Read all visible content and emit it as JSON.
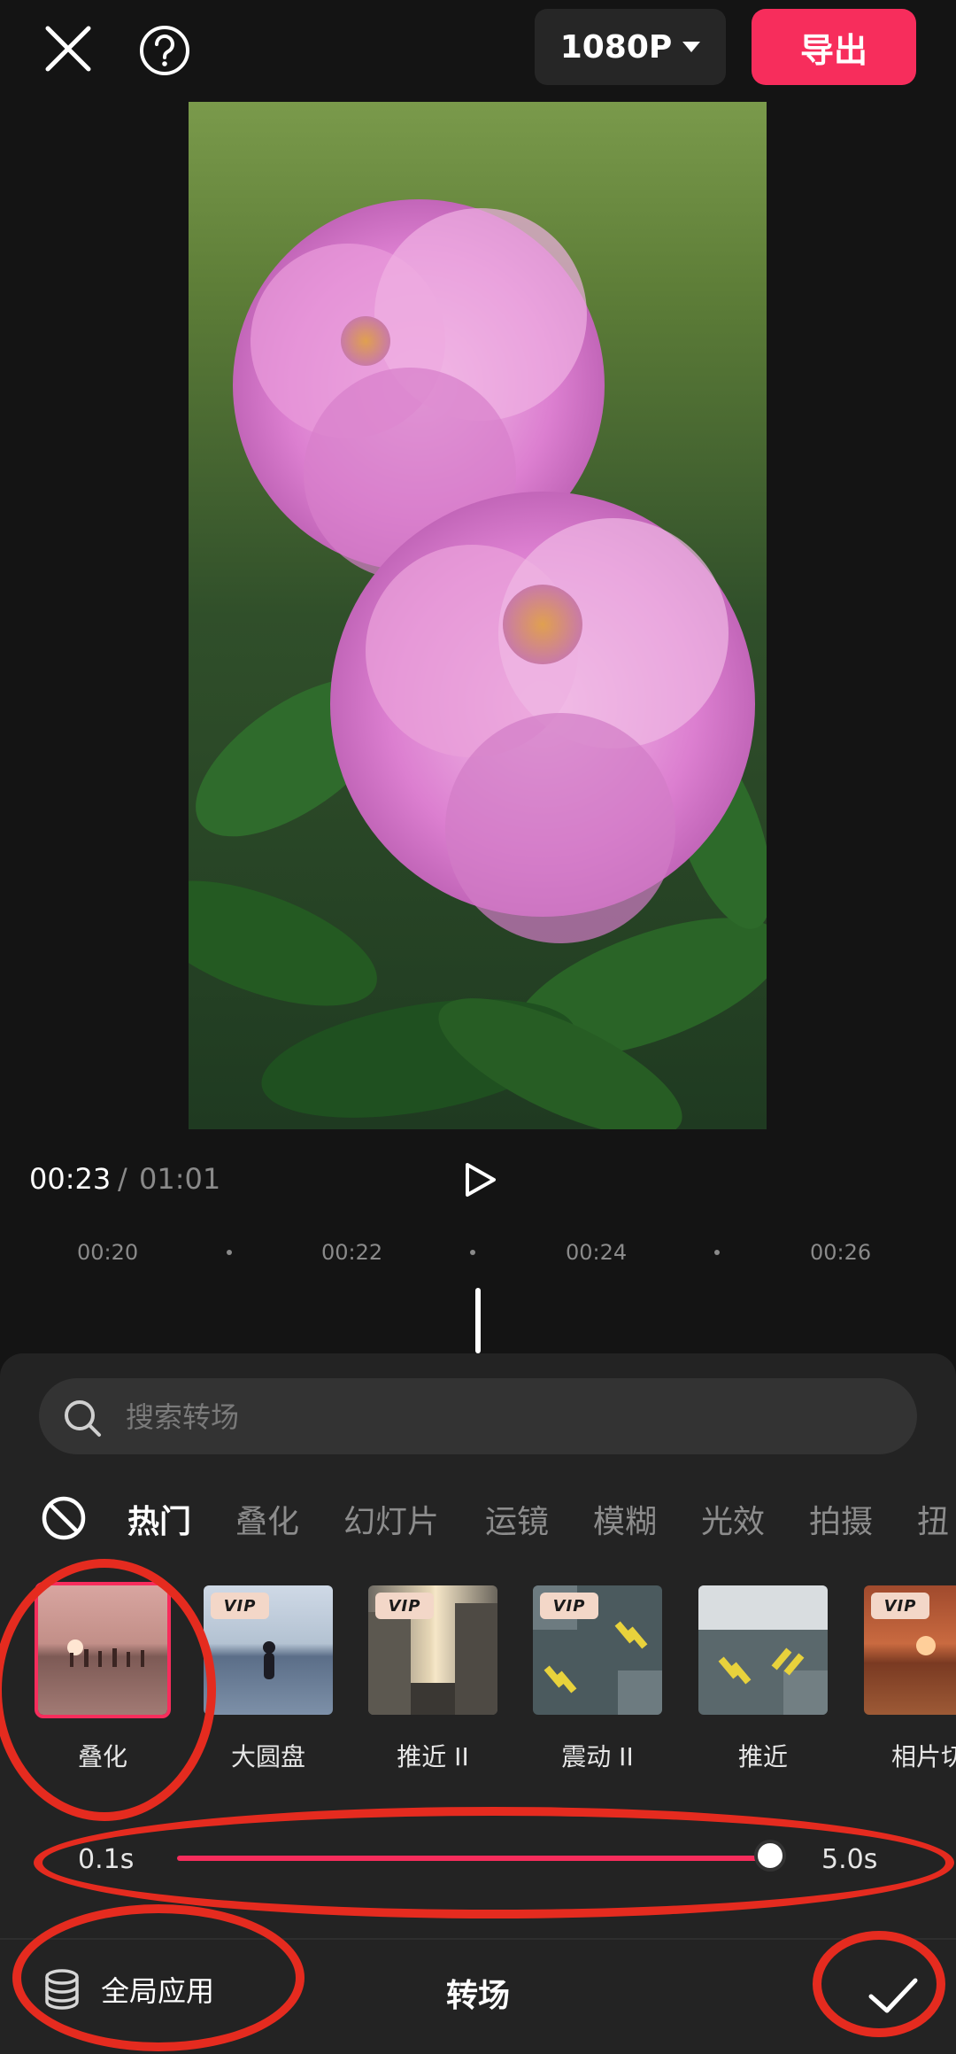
{
  "top_bar": {
    "resolution_label": "1080P",
    "export_label": "导出"
  },
  "playback": {
    "current_time": "00:23",
    "separator": "/",
    "total_time": "01:01"
  },
  "timeline": {
    "ticks": [
      "00:20",
      "00:22",
      "00:24",
      "00:26"
    ]
  },
  "search": {
    "placeholder": "搜索转场"
  },
  "categories": [
    {
      "label": "热门",
      "active": true
    },
    {
      "label": "叠化",
      "active": false
    },
    {
      "label": "幻灯片",
      "active": false
    },
    {
      "label": "运镜",
      "active": false
    },
    {
      "label": "模糊",
      "active": false
    },
    {
      "label": "光效",
      "active": false
    },
    {
      "label": "拍摄",
      "active": false
    },
    {
      "label": "扭",
      "active": false
    }
  ],
  "transitions": [
    {
      "label": "叠化",
      "vip": false,
      "selected": true
    },
    {
      "label": "大圆盘",
      "vip": true,
      "selected": false
    },
    {
      "label": "推近 II",
      "vip": true,
      "selected": false
    },
    {
      "label": "震动 II",
      "vip": true,
      "selected": false
    },
    {
      "label": "推近",
      "vip": false,
      "selected": false
    },
    {
      "label": "相片切",
      "vip": true,
      "selected": false
    }
  ],
  "vip_badge": "VIP",
  "duration_slider": {
    "min_label": "0.1s",
    "max_label": "5.0s",
    "value_fraction": 0.92
  },
  "bottom_bar": {
    "apply_all_label": "全局应用",
    "title": "转场"
  },
  "colors": {
    "accent": "#f72d5c",
    "annotation": "#e52b1f"
  }
}
